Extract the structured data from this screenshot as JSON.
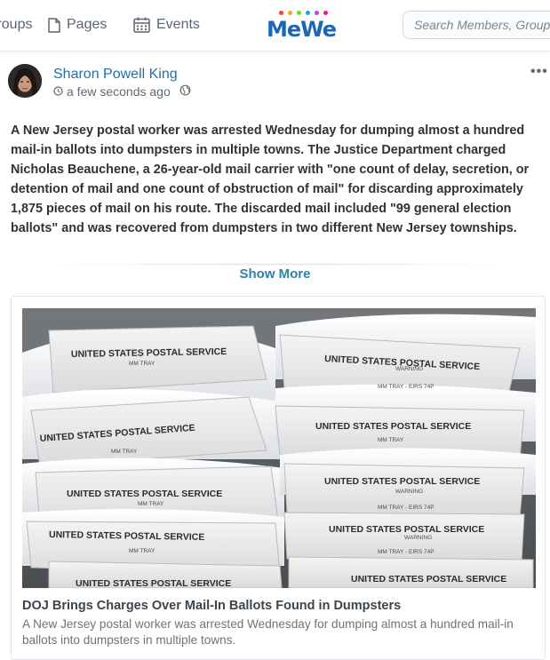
{
  "nav": {
    "groups_label": "Groups",
    "pages_label": "Pages",
    "events_label": "Events",
    "logo_text": "MeWe",
    "search_placeholder": "Search Members, Groups, Pages"
  },
  "post": {
    "author": "Sharon Powell King",
    "timestamp": "a few seconds ago",
    "body": "A New Jersey postal worker was arrested Wednesday for dumping almost a hundred mail-in ballots into dumpsters in multiple towns. The Justice Department charged Nicholas Beauchene, a 26-year-old mail carrier with \"one count of delay, secretion, or detention of mail and one count of obstruction of mail\" for discarding approximately 1,875 pieces of mail on his route. The discarded mail included \"99 general election ballots\" and was recovered from dumpsters in two different New Jersey townships.",
    "show_more_label": "Show More",
    "more_icon": "•••"
  },
  "link_card": {
    "title": "DOJ Brings Charges Over Mail-In Ballots Found in Dumpsters",
    "description": "A New Jersey postal worker was arrested Wednesday for dumping almost a hundred mail-in ballots into dumpsters in multiple towns.",
    "image_labels": {
      "service": "UNITED STATES POSTAL SERVICE",
      "tray": "MM TRAY",
      "warning": "WARNING",
      "eirs": "MM TRAY - EIRS 74P"
    }
  },
  "colors": {
    "accent": "#1f6fa8",
    "show_more": "#2d82a6",
    "logo_dots": [
      "#e8453c",
      "#f5a623",
      "#7ed321",
      "#2d9cdb",
      "#9b51e0",
      "#e91e8c"
    ]
  },
  "icons": {
    "pages": "document-icon",
    "events": "calendar-icon",
    "time": "clock-icon",
    "visibility": "globe-icon",
    "more": "more-dots-icon"
  }
}
